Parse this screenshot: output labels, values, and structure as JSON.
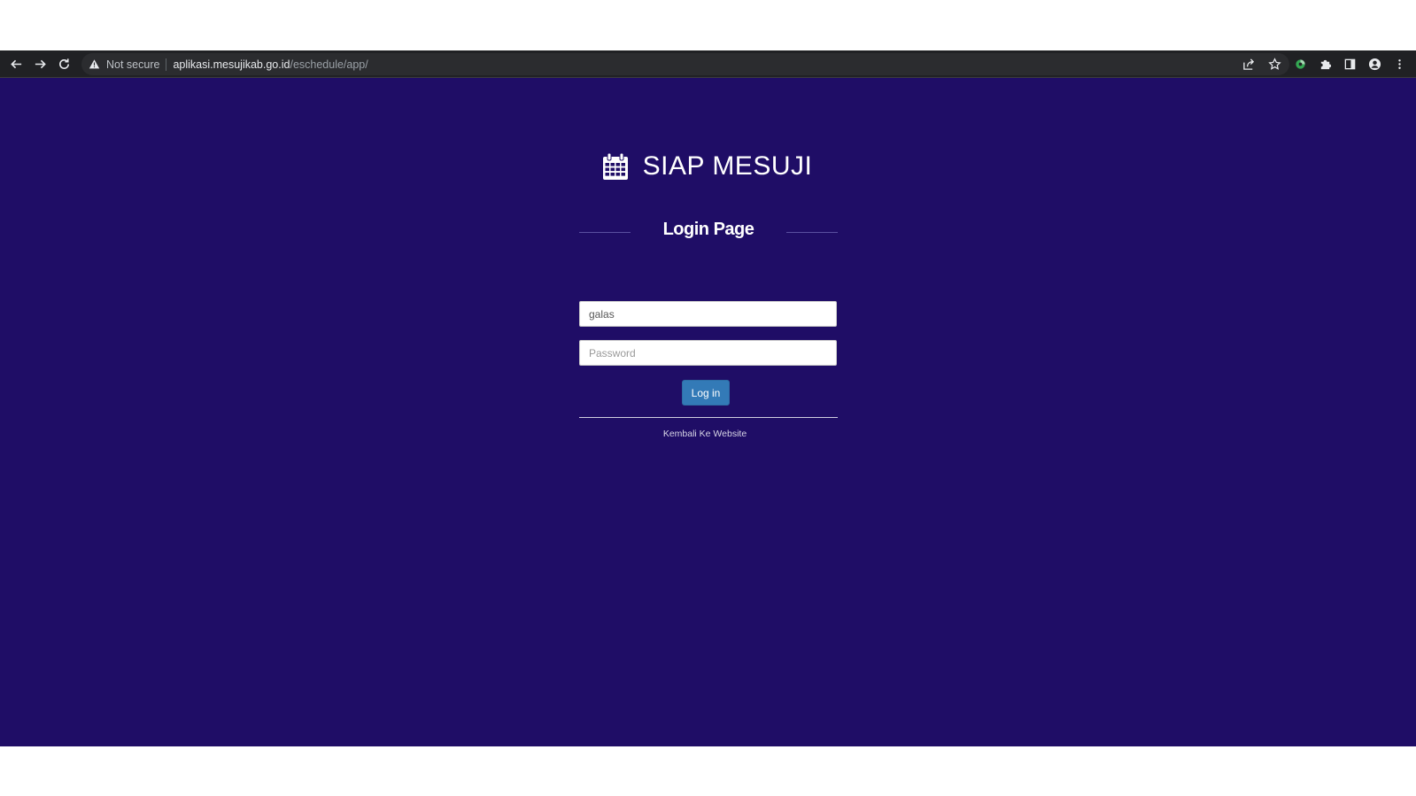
{
  "browser": {
    "security_label": "Not secure",
    "url_host": "aplikasi.mesujikab.go.id",
    "url_path": "/eschedule/app/"
  },
  "page": {
    "background_color": "#1f0d66",
    "app_title": "SIAP MESUJI",
    "login_heading": "Login Page",
    "username_value": "galas",
    "password_placeholder": "Password",
    "login_button_label": "Log in",
    "back_link_text": "Kembali Ke Website",
    "button_color": "#337ab7"
  },
  "icons": {
    "brand": "calendar-icon",
    "back": "arrow-left-icon",
    "forward": "arrow-right-icon",
    "reload": "reload-icon",
    "warning": "warning-icon",
    "share": "share-icon",
    "bookmark": "star-icon",
    "extension_app": "extension-app-icon",
    "extensions": "puzzle-icon",
    "side_panel": "side-panel-icon",
    "profile": "profile-icon",
    "menu": "kebab-menu-icon"
  }
}
